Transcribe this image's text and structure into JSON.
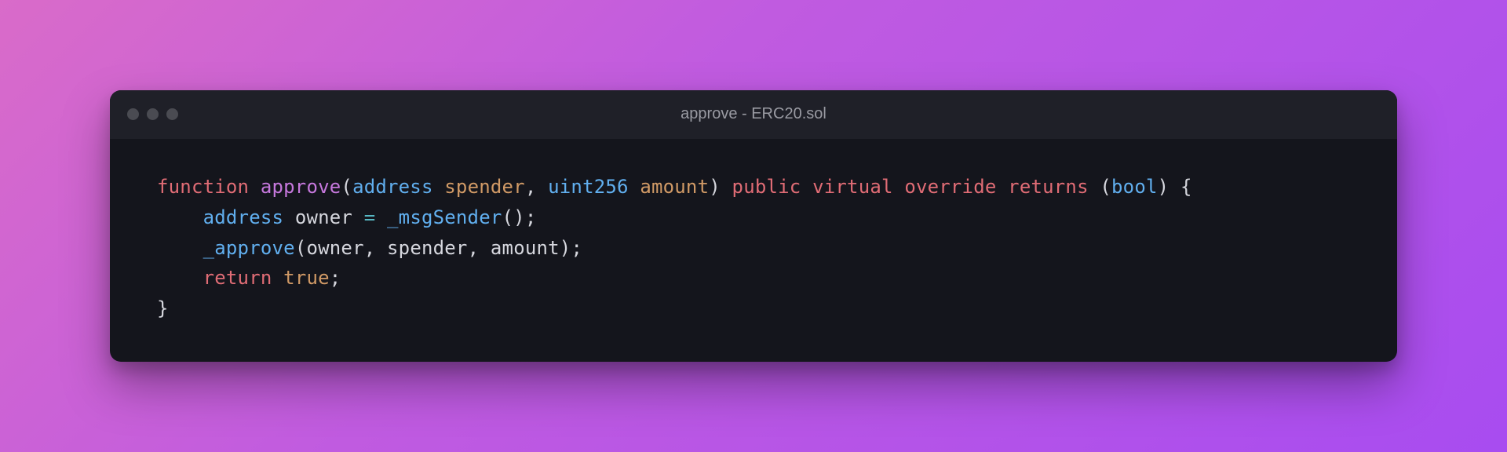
{
  "window": {
    "title": "approve - ERC20.sol"
  },
  "code": {
    "indent1": "    ",
    "line1": {
      "kw_function": "function",
      "fn_name": "approve",
      "type_address": "address",
      "param_spender": "spender",
      "type_uint256": "uint256",
      "param_amount": "amount",
      "mod_public": "public",
      "mod_virtual": "virtual",
      "mod_override": "override",
      "kw_returns": "returns",
      "type_bool": "bool",
      "open_paren1": "(",
      "comma1": ",",
      "close_paren1": ")",
      "open_paren2": " (",
      "close_paren2": ")",
      "brace_open": " {"
    },
    "line2": {
      "type_address": "address",
      "id_owner": "owner",
      "op_eq": " = ",
      "fn_msgSender": "_msgSender",
      "parens": "()",
      "semi": ";"
    },
    "line3": {
      "fn_approve": "_approve",
      "open": "(",
      "arg_owner": "owner",
      "c1": ", ",
      "arg_spender": "spender",
      "c2": ", ",
      "arg_amount": "amount",
      "close": ")",
      "semi": ";"
    },
    "line4": {
      "kw_return": "return",
      "sp": " ",
      "val_true": "true",
      "semi": ";"
    },
    "line5": {
      "brace_close": "}"
    }
  }
}
